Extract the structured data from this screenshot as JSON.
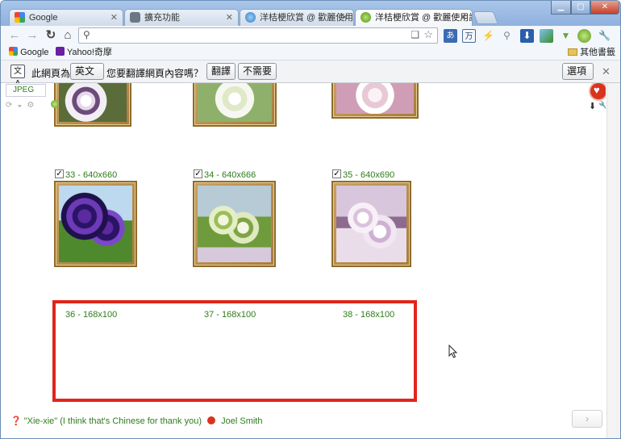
{
  "tabs": [
    {
      "title": "Google",
      "icon": "google-icon"
    },
    {
      "title": "擴充功能",
      "icon": "puzzle-icon"
    },
    {
      "title": "洋桔梗欣賞 @ 歡麗使用說",
      "icon": "globe-icon"
    },
    {
      "title": "洋桔梗欣賞 @ 歡麗使用說",
      "icon": "leaf-icon"
    }
  ],
  "address": {
    "value": ""
  },
  "bookmarks": {
    "items": [
      {
        "label": "Google",
        "icon": "google-icon"
      },
      {
        "label": "Yahoo!奇摩",
        "icon": "yahoo-icon"
      }
    ],
    "other": "其他書籤"
  },
  "infobar": {
    "prefix": "此網頁為",
    "language": "英文",
    "question": "您要翻譯網頁內容嗎？",
    "translate": "翻譯",
    "decline": "不需要",
    "options": "選項"
  },
  "side_panel": {
    "format": "JPEG"
  },
  "gallery": {
    "row2": [
      {
        "caption": "33 - 640x660",
        "checked": true
      },
      {
        "caption": "34 - 640x666",
        "checked": true
      },
      {
        "caption": "35 - 640x690",
        "checked": true
      }
    ],
    "row3": [
      {
        "caption": "36 - 168x100"
      },
      {
        "caption": "37 - 168x100"
      },
      {
        "caption": "38 - 168x100"
      }
    ]
  },
  "footer": {
    "quote": "\"Xie-xie\" (I think that's Chinese for thank you)",
    "author": "Joel Smith"
  },
  "colors": {
    "accent_red": "#e0251b",
    "caption_green": "#2e7d1a",
    "frame_gold": "#a97c3c"
  }
}
